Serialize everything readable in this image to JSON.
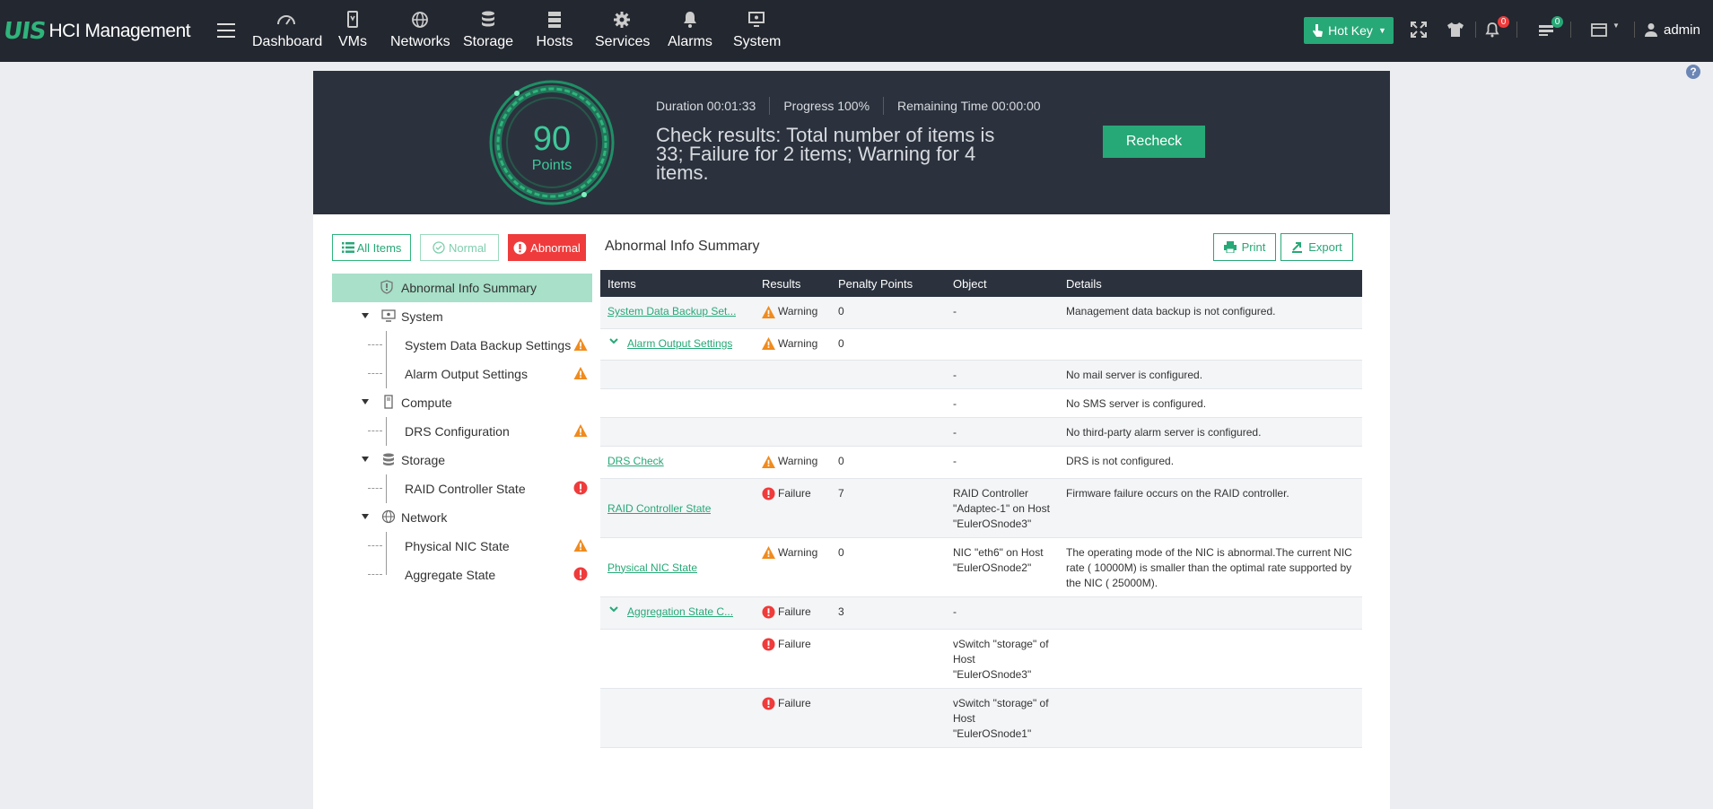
{
  "app": {
    "logo_mark": "UIS",
    "title": "HCI Management",
    "nav": [
      {
        "label": "Dashboard",
        "icon": "gauge-icon"
      },
      {
        "label": "VMs",
        "icon": "vm-icon"
      },
      {
        "label": "Networks",
        "icon": "globe-icon"
      },
      {
        "label": "Storage",
        "icon": "database-icon"
      },
      {
        "label": "Hosts",
        "icon": "server-icon"
      },
      {
        "label": "Services",
        "icon": "gear-icon"
      },
      {
        "label": "Alarms",
        "icon": "bell-icon"
      },
      {
        "label": "System",
        "icon": "monitor-icon"
      }
    ],
    "hotkey_label": "Hot Key",
    "alarm_badge": "0",
    "task_badge": "0",
    "user": "admin",
    "help": "?"
  },
  "hero": {
    "score": "90",
    "score_unit": "Points",
    "duration": "Duration 00:01:33",
    "progress": "Progress 100%",
    "remaining": "Remaining Time 00:00:00",
    "check_results": "Check results: Total number of items is 33; Failure for 2 items; Warning for 4 items.",
    "recheck_label": "Recheck"
  },
  "filters": {
    "all": "All Items",
    "normal": "Normal",
    "abnormal": "Abnormal"
  },
  "tree": {
    "summary": "Abnormal Info Summary",
    "system": "System",
    "system_backup": "System Data Backup Settings",
    "alarm_output": "Alarm Output Settings",
    "compute": "Compute",
    "drs": "DRS Configuration",
    "storage": "Storage",
    "raid": "RAID Controller State",
    "network": "Network",
    "nic": "Physical NIC State",
    "aggregate": "Aggregate State"
  },
  "summary": {
    "title": "Abnormal Info Summary",
    "print": "Print",
    "export": "Export",
    "columns": [
      "Items",
      "Results",
      "Penalty Points",
      "Object",
      "Details"
    ],
    "rows": [
      {
        "item": "System Data Backup Set...",
        "result": "Warning",
        "points": "0",
        "object": "-",
        "details": "Management data backup is not configured."
      },
      {
        "item": "Alarm Output Settings",
        "result": "Warning",
        "points": "0",
        "object": "",
        "details": ""
      },
      {
        "item": "",
        "result": "",
        "points": "",
        "object": "-",
        "details": "No mail server is configured."
      },
      {
        "item": "",
        "result": "",
        "points": "",
        "object": "-",
        "details": "No SMS server is configured."
      },
      {
        "item": "",
        "result": "",
        "points": "",
        "object": "-",
        "details": "No third-party alarm server is configured."
      },
      {
        "item": "DRS Check",
        "result": "Warning",
        "points": "0",
        "object": "-",
        "details": "DRS is not configured."
      },
      {
        "item": "RAID Controller State",
        "result": "Failure",
        "points": "7",
        "object": "RAID Controller \"Adaptec-1\" on Host \"EulerOSnode3\"",
        "details": "Firmware failure occurs on the RAID controller."
      },
      {
        "item": "Physical NIC State",
        "result": "Warning",
        "points": "0",
        "object": "NIC \"eth6\" on Host \"EulerOSnode2\"",
        "details": "The operating mode of the NIC is abnormal.The current NIC rate ( 10000M) is smaller than the optimal rate supported by the NIC ( 25000M)."
      },
      {
        "item": "Aggregation State C...",
        "result": "Failure",
        "points": "3",
        "object": "-",
        "details": ""
      },
      {
        "item": "",
        "result": "Failure",
        "points": "",
        "object": "vSwitch \"storage\" of Host \"EulerOSnode3\"",
        "details": ""
      },
      {
        "item": "",
        "result": "Failure",
        "points": "",
        "object": "vSwitch \"storage\" of Host \"EulerOSnode1\"",
        "details": ""
      }
    ]
  },
  "colors": {
    "brand": "#27a877",
    "warning": "#f08b1d",
    "failure": "#ef3b3b",
    "header": "#23272f"
  }
}
